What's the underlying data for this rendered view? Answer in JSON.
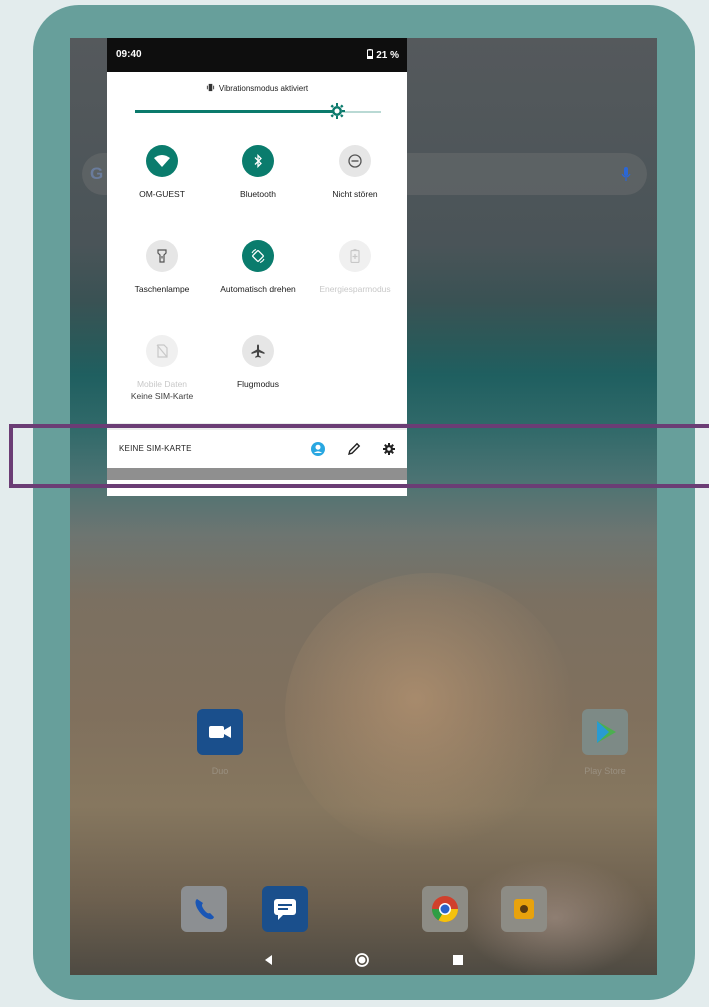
{
  "status": {
    "time": "09:40",
    "battery": "21 %"
  },
  "vibration": {
    "label": "Vibrationsmodus aktiviert"
  },
  "brightness": {
    "level": 0.82
  },
  "tiles": [
    {
      "label": "OM-GUEST",
      "icon": "wifi-icon",
      "state": "on"
    },
    {
      "label": "Bluetooth",
      "icon": "bluetooth-icon",
      "state": "on"
    },
    {
      "label": "Nicht stören",
      "icon": "do-not-disturb-icon",
      "state": "off"
    },
    {
      "label": "Taschenlampe",
      "icon": "flashlight-icon",
      "state": "off"
    },
    {
      "label": "Automatisch drehen",
      "icon": "auto-rotate-icon",
      "state": "on"
    },
    {
      "label": "Energiesparmodus",
      "icon": "battery-saver-icon",
      "state": "disabled"
    },
    {
      "label": "Mobile Daten",
      "sub": "Keine SIM-Karte",
      "icon": "mobile-data-icon",
      "state": "disabled"
    },
    {
      "label": "Flugmodus",
      "icon": "airplane-icon",
      "state": "off"
    }
  ],
  "footer": {
    "carrier": "KEINE SIM-KARTE"
  },
  "home": {
    "apps": [
      {
        "label": "Duo"
      },
      {
        "label": "Play Store"
      }
    ]
  },
  "colors": {
    "accent": "#0a7c6d",
    "highlight": "#6b3d75"
  }
}
